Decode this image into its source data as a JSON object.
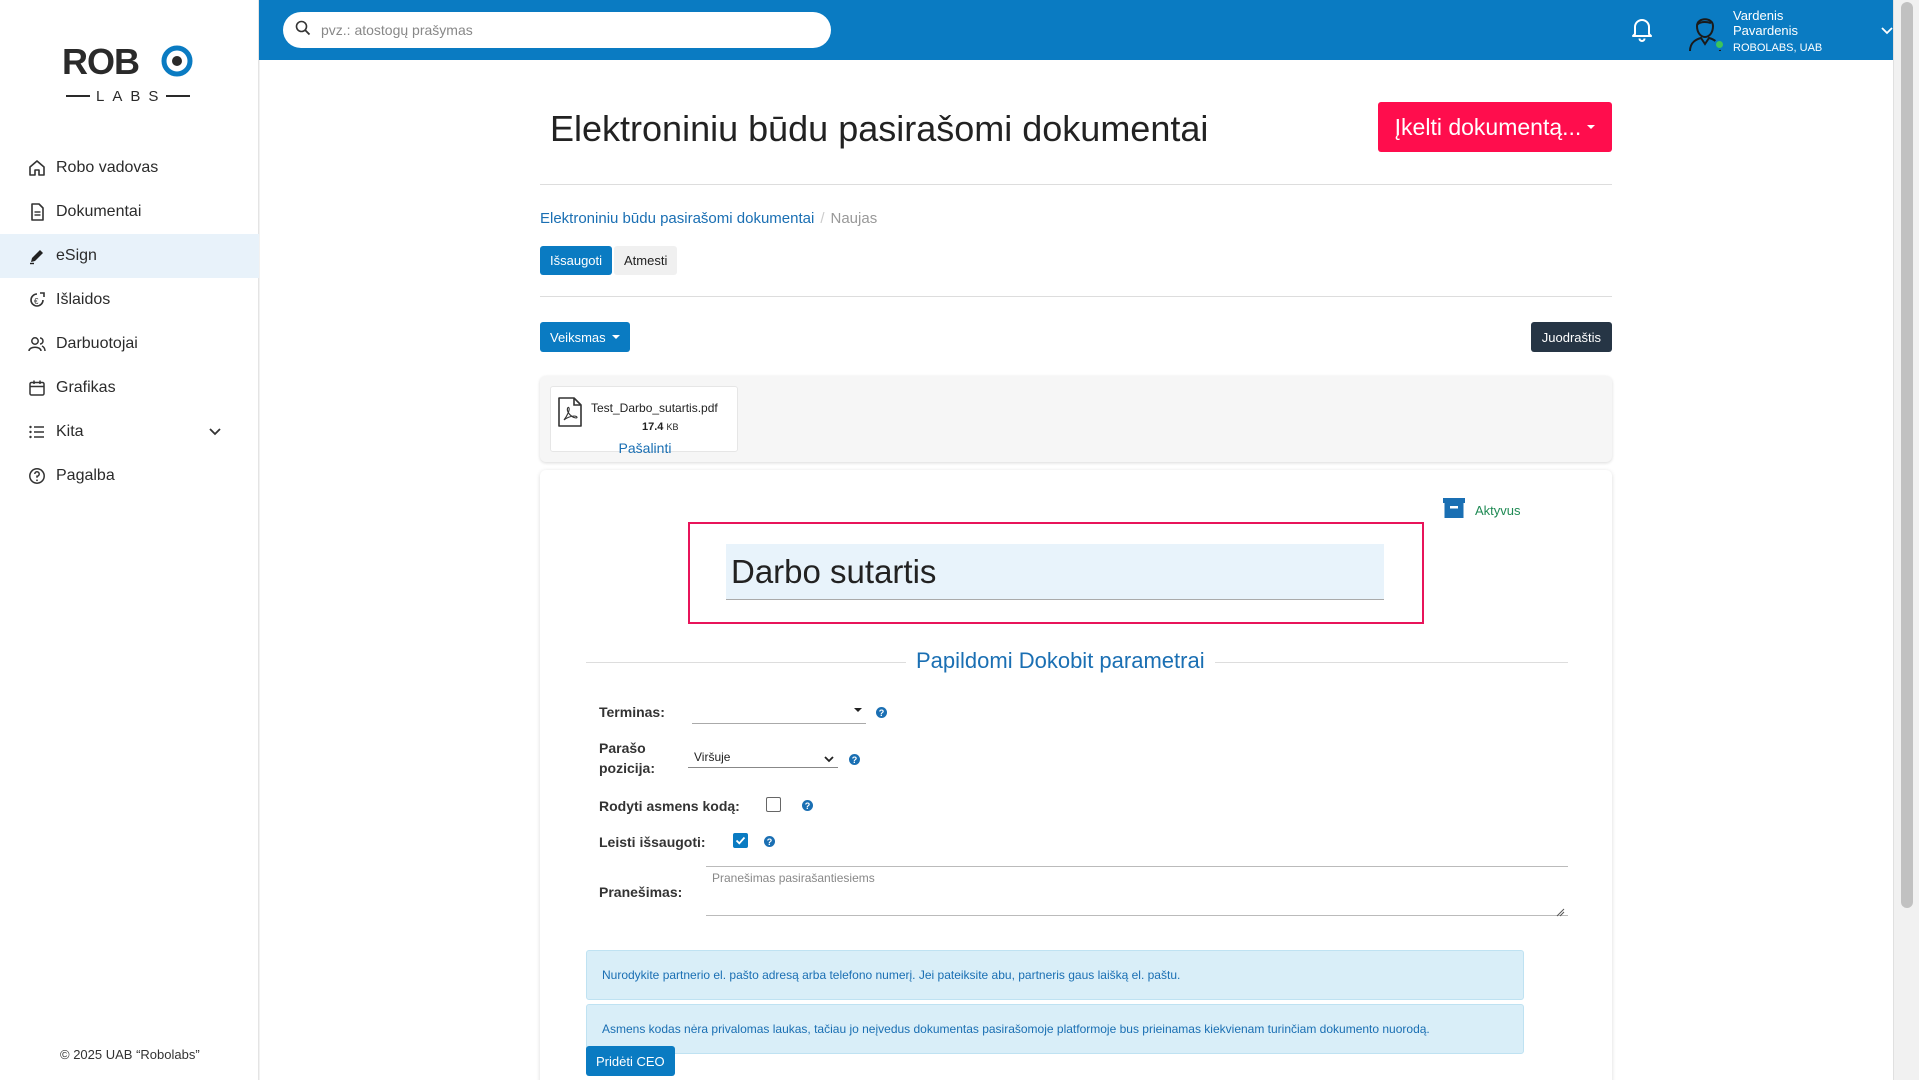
{
  "sidebar": {
    "logo": {
      "top": "ROBO",
      "bottom": "LABS"
    },
    "items": [
      {
        "label": "Robo vadovas",
        "icon": "home-icon"
      },
      {
        "label": "Dokumentai",
        "icon": "document-icon"
      },
      {
        "label": "eSign",
        "icon": "pen-icon",
        "active": true
      },
      {
        "label": "Išlaidos",
        "icon": "expenses-icon"
      },
      {
        "label": "Darbuotojai",
        "icon": "users-icon"
      },
      {
        "label": "Grafikas",
        "icon": "calendar-icon"
      },
      {
        "label": "Kita",
        "icon": "list-icon"
      },
      {
        "label": "Pagalba",
        "icon": "help-icon"
      }
    ],
    "copyright": "© 2025 UAB “Robolabs”"
  },
  "topbar": {
    "search_placeholder": "pvz.: atostogų prašymas",
    "user_name": "Vardenis Pavardenis",
    "user_company": "ROBOLABS, UAB"
  },
  "page": {
    "title": "Elektroniniu būdu pasirašomi dokumentai",
    "upload_label": "Įkelti dokumentą...",
    "breadcrumb": {
      "link": "Elektroniniu būdu pasirašomi dokumentai",
      "current": "Naujas"
    },
    "save_label": "Išsaugoti",
    "discard_label": "Atmesti",
    "action_label": "Veiksmas",
    "draft_label": "Juodraštis"
  },
  "attachment": {
    "filename": "Test_Darbo_sutartis.pdf",
    "size": "17.4",
    "unit": "KB",
    "remove_label": "Pašalinti"
  },
  "form": {
    "status": "Aktyvus",
    "document_title": "Darbo sutartis",
    "section_title": "Papildomi Dokobit parametrai",
    "term_label": "Terminas:",
    "term_value": "",
    "position_label_1": "Parašo",
    "position_label_2": "pozicija:",
    "position_value": "Viršuje",
    "show_code_label": "Rodyti asmens kodą:",
    "show_code_checked": false,
    "allow_save_label": "Leisti išsaugoti:",
    "allow_save_checked": true,
    "message_label": "Pranešimas:",
    "message_placeholder": "Pranešimas pasirašantiesiems",
    "info_1": "Nurodykite partnerio el. pašto adresą arba telefono numerį. Jei pateiksite abu, partneris gaus laišką el. paštu.",
    "info_2": "Asmens kodas nėra privalomas laukas, tačiau jo neįvedus dokumentas pasirašomoje platformoje bus prieinamas kiekvienam turinčiam dokumento nuorodą.",
    "add_ceo_label": "Pridėti CEO"
  },
  "colors": {
    "brand_blue": "#0a7bc2",
    "upload_red": "#ff0d4d",
    "status_green": "#1f8a54",
    "title_border": "#e8145a"
  }
}
